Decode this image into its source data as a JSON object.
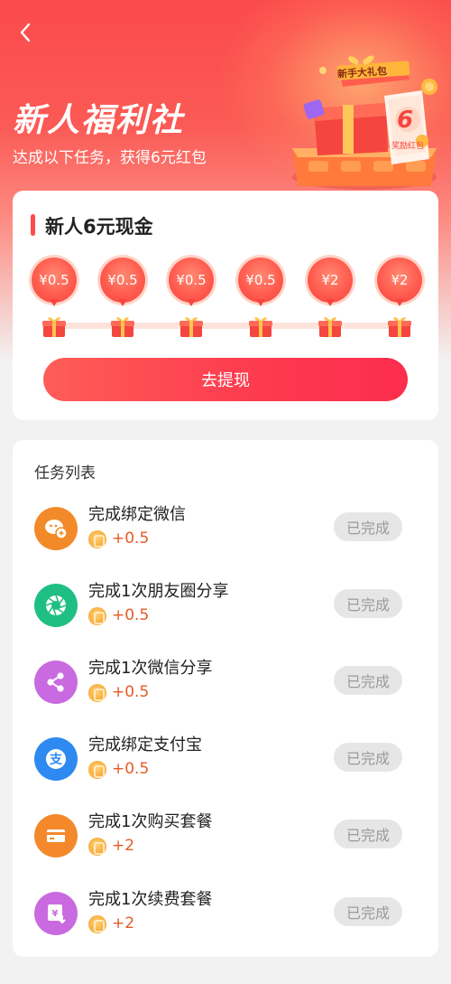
{
  "header": {
    "title": "新人福利社",
    "subtitle": "达成以下任务，获得6元红包",
    "back_icon": "chevron-left-icon"
  },
  "promo_art": {
    "ribbon_text": "新手大礼包",
    "coupon_big": "6",
    "coupon_small": "奖励红包"
  },
  "reward_card": {
    "title": "新人6元现金",
    "milestones": [
      {
        "amount": "¥0.5"
      },
      {
        "amount": "¥0.5"
      },
      {
        "amount": "¥0.5"
      },
      {
        "amount": "¥0.5"
      },
      {
        "amount": "¥2"
      },
      {
        "amount": "¥2"
      }
    ],
    "withdraw_label": "去提现"
  },
  "task_list": {
    "title": "任务列表",
    "items": [
      {
        "name": "完成绑定微信",
        "reward": "+0.5",
        "status": "已完成",
        "icon": "wechat-icon",
        "color": "#f38a2a"
      },
      {
        "name": "完成1次朋友圈分享",
        "reward": "+0.5",
        "status": "已完成",
        "icon": "moments-icon",
        "color": "#1fbf84"
      },
      {
        "name": "完成1次微信分享",
        "reward": "+0.5",
        "status": "已完成",
        "icon": "share-icon",
        "color": "#c96ae0"
      },
      {
        "name": "完成绑定支付宝",
        "reward": "+0.5",
        "status": "已完成",
        "icon": "alipay-icon",
        "color": "#2e8af0"
      },
      {
        "name": "完成1次购买套餐",
        "reward": "+2",
        "status": "已完成",
        "icon": "card-icon",
        "color": "#f3892b"
      },
      {
        "name": "完成1次续费套餐",
        "reward": "+2",
        "status": "已完成",
        "icon": "renew-icon",
        "color": "#c96ae0"
      }
    ]
  },
  "colors": {
    "brand_red": "#fd4b4e",
    "reward_orange": "#e55b25",
    "done_badge_bg": "#e6e6e6"
  }
}
